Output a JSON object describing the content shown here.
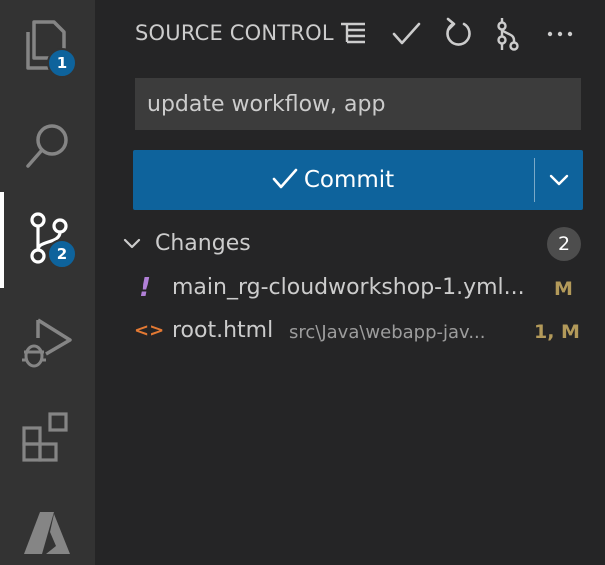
{
  "activity_bar": {
    "explorer_badge": "1",
    "source_control_badge": "2"
  },
  "sidebar": {
    "title": "SOURCE CONTROL",
    "commit_message": "update workflow, app",
    "commit_label": "Commit",
    "changes_label": "Changes",
    "changes_count": "2",
    "files": [
      {
        "name": "main_rg-cloudworkshop-1.yml...",
        "path": "",
        "status": "M",
        "icon": "exclamation-icon"
      },
      {
        "name": "root.html",
        "path": "src\\Java\\webapp-jav...",
        "status": "1, M",
        "icon": "html-code-icon"
      }
    ]
  },
  "colors": {
    "accent": "#0e639c",
    "modified": "#b39a5a",
    "yml_icon": "#b180d7",
    "html_icon": "#e37933"
  }
}
